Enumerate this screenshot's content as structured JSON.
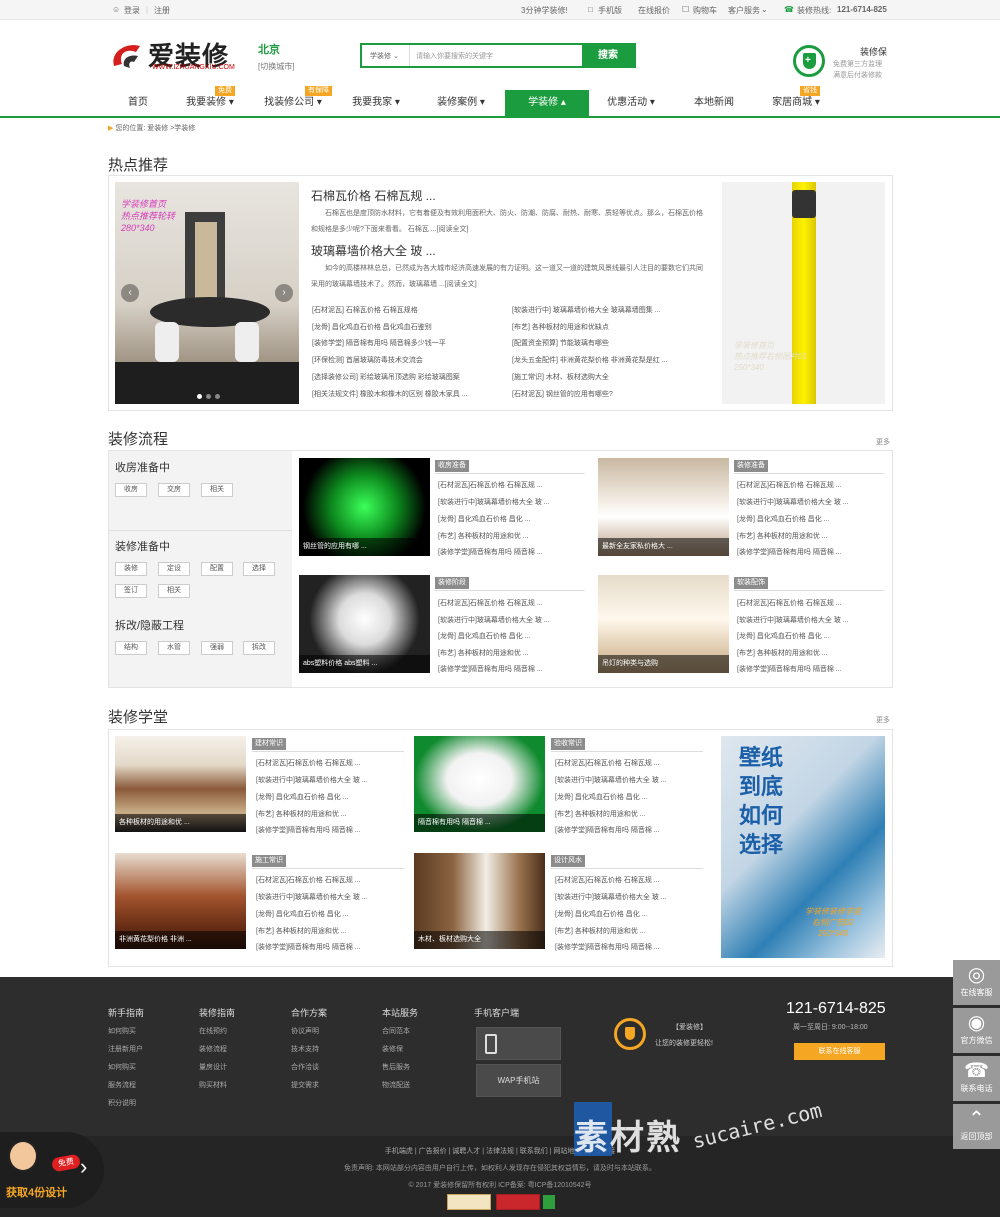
{
  "topbar": {
    "login": "登录",
    "register": "注册",
    "links": [
      "3分钟学装修!",
      "手机版",
      "在线报价",
      "购物车",
      "客户服务"
    ],
    "hotline_label": "装修热线:",
    "hotline": "121-6714-825"
  },
  "header": {
    "logo_text": "爱装修",
    "logo_sub": "WWW.IZHUANGXIU.COM",
    "city": "北京",
    "city_switch": "[切换城市]",
    "search_category": "学装修",
    "search_placeholder": "请输入你要搜索的关键字",
    "search_button": "搜索",
    "guarantee_title": "装修保",
    "guarantee_sub": "免费第三方监理\n满意后付装修款"
  },
  "nav": {
    "items": [
      "首页",
      "我要装修",
      "找装修公司",
      "我要我家",
      "装修案例",
      "学装修",
      "优惠活动",
      "本地新闻",
      "家居商城"
    ],
    "badges": [
      "免费",
      "有保障",
      "省钱"
    ]
  },
  "breadcrumb": "您的位置: 爱装修 >学装修",
  "hot": {
    "title": "热点推荐",
    "banner_left": "学装修首页\n热点推荐轮转\n280*340",
    "banner_right": "学装修首页\n热点推荐右侧图片01\n250*340",
    "article1_title": "石棉瓦价格 石棉瓦规 ...",
    "article1_body": "石棉瓦也是度顶防水材料，它有着便及有效利用面积大、防火、防潮、防腐、耐热、耐寒、质轻等优点。那么，石棉瓦价格和规格是多少呢?下面来看看。 石棉瓦 ...[阅读全文]",
    "article2_title": "玻璃幕墙价格大全 玻 ...",
    "article2_body": "如今的高楼林林总总，已然成为各大城市经济高速发展的有力证明。这一道又一道的建筑风景线最引人注目的要数它们共同采用的玻璃幕墙技术了。然而，玻璃幕墙 ...[阅读全文]",
    "links_left": [
      "[石材泥瓦] 石棉瓦价格 石棉瓦规格",
      "[龙骨] 昌化鸡血石价格 昌化鸡血石鉴别",
      "[装修学堂] 隔音棉有用吗 隔音棉多少钱一平",
      "[环保检测] 首届玻璃防毒技术交流会",
      "[选择装修公司] 彩绘玻璃吊顶选购 彩绘玻璃图案",
      "[相关法规文件] 橡胶木和橡木的区别 橡胶木家具 ..."
    ],
    "links_right": [
      "[软装进行中] 玻璃幕墙价格大全 玻璃幕墙图集 ...",
      "[布艺] 各种板材的用途和优缺点",
      "[配置资金预算] 节能玻璃有哪些",
      "[龙头五金配件] 非洲黄花梨价格 非洲黄花梨是红 ...",
      "[施工常识] 木材、板材选购大全",
      "[石材泥瓦] 钢丝管的应用有哪些?"
    ]
  },
  "process": {
    "title": "装修流程",
    "more": "更多",
    "groups": [
      {
        "title": "收房准备中",
        "tags": [
          "收房",
          "交房",
          "相关"
        ]
      },
      {
        "title": "装修准备中",
        "tags": [
          "装修",
          "定设",
          "配置",
          "选择",
          "签订",
          "相关"
        ]
      },
      {
        "title": "拆改/隐蔽工程",
        "tags": [
          "结构",
          "水管",
          "强弱",
          "拆改"
        ]
      }
    ],
    "cards": [
      {
        "caption": "钢丝管的应用有哪 ...",
        "tag": "收房准备"
      },
      {
        "caption": "最新全友家私价格大 ...",
        "tag": "装修准备"
      },
      {
        "caption": "abs塑料价格 abs塑料 ...",
        "tag": "装修阶段"
      },
      {
        "caption": "吊灯的种类与选购",
        "tag": "软装配饰"
      }
    ],
    "list": [
      "[石材泥瓦]石棉瓦价格 石棉瓦规 ...",
      "[软装进行中]玻璃幕墙价格大全 玻 ...",
      "[龙骨] 昌化鸡血石价格 昌化 ...",
      "[布艺] 各种板材的用途和优 ...",
      "[装修学堂]隔音棉有用吗 隔音棉 ..."
    ]
  },
  "school": {
    "title": "装修学堂",
    "more": "更多",
    "cards": [
      {
        "caption": "各种板材的用途和优 ...",
        "tag": "建材常识"
      },
      {
        "caption": "隔音棉有用吗 隔音棉 ...",
        "tag": "验收常识"
      },
      {
        "caption": "非洲黄花梨价格 非洲 ...",
        "tag": "施工常识"
      },
      {
        "caption": "木材、板材选购大全",
        "tag": "设计风水"
      }
    ],
    "list": [
      "[石材泥瓦]石棉瓦价格 石棉瓦规 ...",
      "[软装进行中]玻璃幕墙价格大全 玻 ...",
      "[龙骨] 昌化鸡血石价格 昌化 ...",
      "[布艺] 各种板材的用途和优 ...",
      "[装修学堂]隔音棉有用吗 隔音棉 ..."
    ],
    "ad_big": "壁纸\n到底\n如何\n选择",
    "ad_small": "学装修装修学堂\n右侧广告B2\n250*340"
  },
  "footer": {
    "cols": [
      {
        "title": "新手指南",
        "items": [
          "如何购买",
          "注册新用户",
          "如何购买",
          "服务流程",
          "积分说明"
        ]
      },
      {
        "title": "装修指南",
        "items": [
          "在线预约",
          "装修流程",
          "量房设计",
          "购买材料"
        ]
      },
      {
        "title": "合作方案",
        "items": [
          "协议声明",
          "技术支持",
          "合作洽谈",
          "提交需求"
        ]
      },
      {
        "title": "本站服务",
        "items": [
          "合同范本",
          "装修保",
          "售后服务",
          "物流配送"
        ]
      }
    ],
    "mobile_title": "手机客户端",
    "wap": "WAP手机站",
    "brand_bracket": "【爱装修】",
    "slogan": "让您的装修更轻松!",
    "phone": "121-6714-825",
    "hours": "周一至周日: 9:00--18:00",
    "online_btn": "联系在线客服",
    "bottom_links": "手机端虎 | 广告报价 | 诚聘人才 | 法律法规 | 联系我们 | 网站地图 | 友情链接",
    "disclaimer": "免责声明: 本网站部分内容由用户自行上传，如权利人发现存在侵犯其权益情形，请及时与本站联系。",
    "copyright": "© 2017 爱装修保留所有权利 ICP备案: 粤ICP备12010542号",
    "watermark_cn": "素材熟",
    "watermark_en": "sucaire.com"
  },
  "float": [
    "在线客服",
    "官方微信",
    "联系电话",
    "返回顶部"
  ],
  "promo": {
    "badge": "免费",
    "text": "获取4份设计"
  },
  "colors": {
    "brand_green": "#1a9c3f",
    "accent_orange": "#f5a623",
    "hotline_red": "#e4393c"
  }
}
